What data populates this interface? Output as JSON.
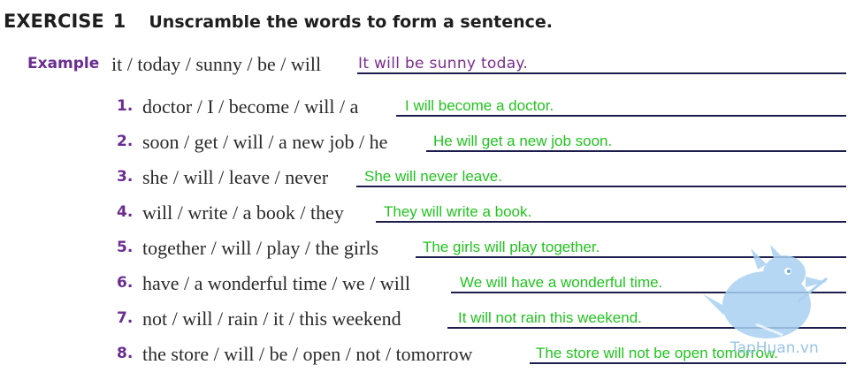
{
  "header": {
    "exercise_word": "EXERCISE",
    "exercise_number": "1",
    "instruction": "Unscramble the words to form a sentence."
  },
  "example": {
    "label": "Example",
    "prompt": "it / today / sunny / be / will",
    "answer": "It will be sunny today."
  },
  "items": [
    {
      "number": "1.",
      "prompt": "doctor / I / become / will / a",
      "answer": "I will become a doctor."
    },
    {
      "number": "2.",
      "prompt": "soon / get / will / a new job / he",
      "answer": "He will get a new job soon."
    },
    {
      "number": "3.",
      "prompt": "she / will / leave / never",
      "answer": "She will never leave."
    },
    {
      "number": "4.",
      "prompt": "will / write / a book / they",
      "answer": "They will write a book."
    },
    {
      "number": "5.",
      "prompt": "together / will / play / the girls",
      "answer": "The girls will play together."
    },
    {
      "number": "6.",
      "prompt": "have / a wonderful time / we / will",
      "answer": "We will have a wonderful time."
    },
    {
      "number": "7.",
      "prompt": "not / will / rain / it / this weekend",
      "answer": "It will not rain this weekend."
    },
    {
      "number": "8.",
      "prompt": "the store / will / be / open / not / tomorrow",
      "answer": "The store will not be open tomorrow."
    }
  ],
  "watermark": {
    "text": "TapHuan.vn",
    "color": "#8cbfe2"
  },
  "colors": {
    "label_purple": "#6a2c91",
    "answer_green": "#22c31f",
    "line_navy": "#1d1d4d"
  }
}
